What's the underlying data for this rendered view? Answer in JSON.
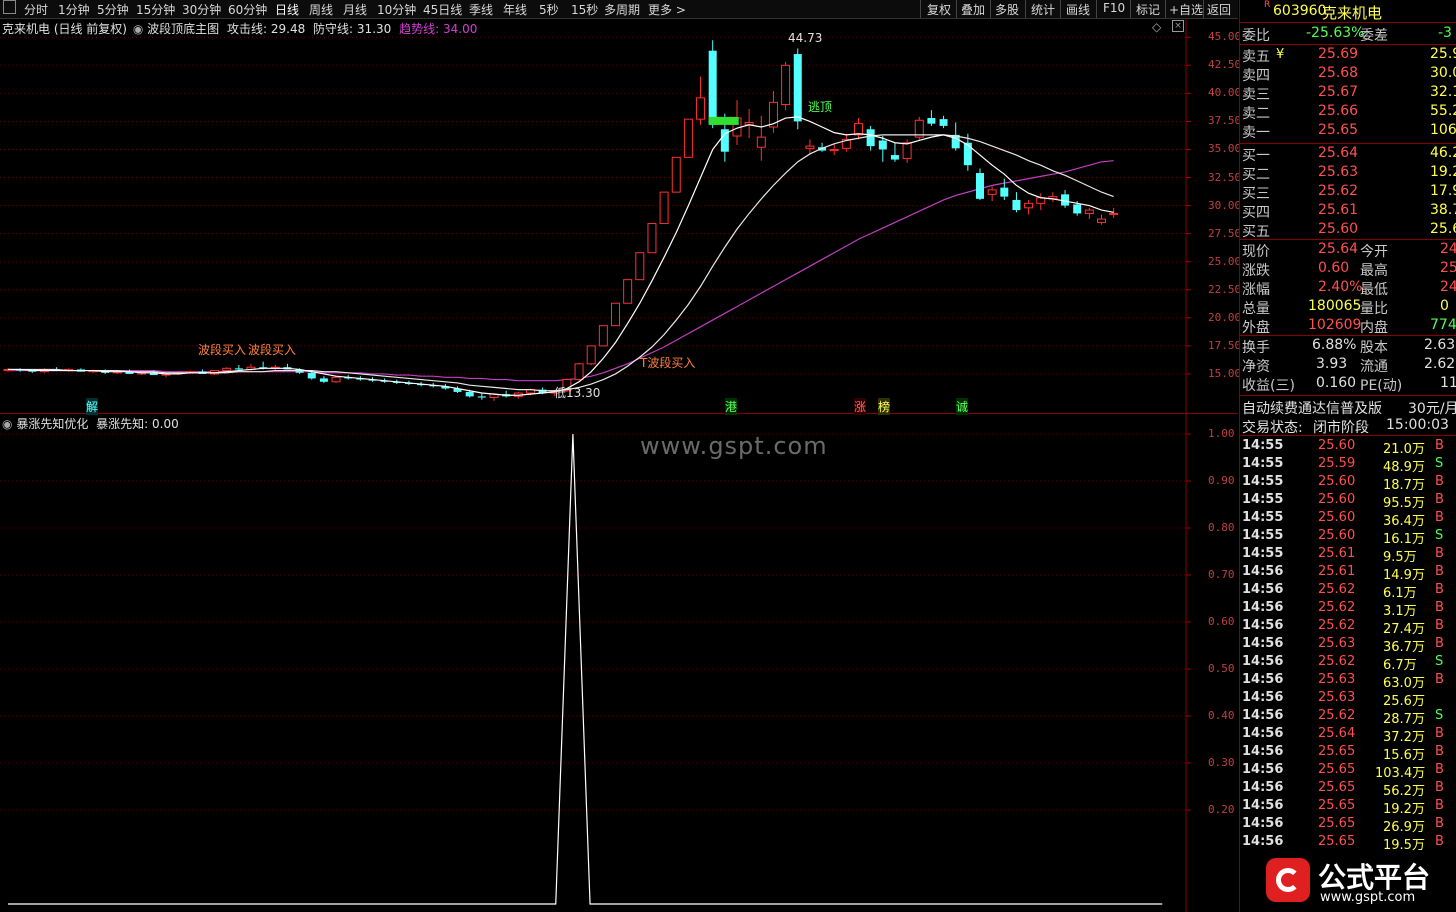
{
  "toolbar": {
    "grid_icon": "grid-icon",
    "periods": [
      "分时",
      "1分钟",
      "5分钟",
      "15分钟",
      "30分钟",
      "60分钟",
      "日线",
      "周线",
      "月线",
      "10分钟",
      "45日线",
      "季线",
      "年线",
      "5秒",
      "15秒",
      "多周期",
      "更多 >"
    ],
    "tools": [
      "复权",
      "叠加",
      "多股",
      "统计",
      "画线",
      "F10",
      "标记",
      "+自选",
      "返回"
    ]
  },
  "main_chart": {
    "stock_title": "克来机电 (日线 前复权)",
    "indicator_name": "波段顶底主图",
    "attack_label": "攻击线:",
    "attack_value": "29.48",
    "defense_label": "防守线:",
    "defense_value": "31.30",
    "trend_label": "趋势线:",
    "trend_value": "34.00",
    "peak_label": "44.73",
    "escape_label": "逃顶",
    "buy_label_1": "波段买入",
    "buy_label_2": "波段买入",
    "low_label": "低13.30",
    "buy_label_3": "T波段买入",
    "price_axis": [
      "45.00",
      "42.50",
      "40.00",
      "37.50",
      "35.00",
      "32.50",
      "30.00",
      "27.50",
      "25.00",
      "22.50",
      "20.00",
      "17.50",
      "15.00"
    ],
    "event_markers": [
      "解",
      "港",
      "涨",
      "榜",
      "诚"
    ]
  },
  "indicator_chart": {
    "title": "暴涨先知优化",
    "series_label": "暴涨先知:",
    "series_value": "0.00",
    "axis": [
      "1.00",
      "0.90",
      "0.80",
      "0.70",
      "0.60",
      "0.50",
      "0.40",
      "0.30",
      "0.20"
    ]
  },
  "watermark": "www.gspt.com",
  "quote_panel": {
    "badge": "R",
    "code": "603960",
    "name": "克来机电",
    "wei_bi_label": "委比",
    "wei_bi_value": "-25.63%",
    "wei_cha_label": "委差",
    "wei_cha_value": "-3",
    "asks": [
      {
        "label": "卖五",
        "price": "25.69",
        "vol": "25.9"
      },
      {
        "label": "卖四",
        "price": "25.68",
        "vol": "30.0"
      },
      {
        "label": "卖三",
        "price": "25.67",
        "vol": "32.1"
      },
      {
        "label": "卖二",
        "price": "25.66",
        "vol": "55.2"
      },
      {
        "label": "卖一",
        "price": "25.65",
        "vol": "106.4"
      }
    ],
    "bids": [
      {
        "label": "买一",
        "price": "25.64",
        "vol": "46.2"
      },
      {
        "label": "买二",
        "price": "25.63",
        "vol": "19.2"
      },
      {
        "label": "买三",
        "price": "25.62",
        "vol": "17.9"
      },
      {
        "label": "买四",
        "price": "25.61",
        "vol": "38.7"
      },
      {
        "label": "买五",
        "price": "25.60",
        "vol": "25.6"
      }
    ],
    "yen_mark": "¥",
    "stats": [
      {
        "l1": "现价",
        "v1": "25.64",
        "l2": "今开",
        "v2": "24"
      },
      {
        "l1": "涨跌",
        "v1": "0.60",
        "l2": "最高",
        "v2": "25"
      },
      {
        "l1": "涨幅",
        "v1": "2.40%",
        "l2": "最低",
        "v2": "24"
      },
      {
        "l1": "总量",
        "v1": "180065",
        "l2": "量比",
        "v2": "0"
      },
      {
        "l1": "外盘",
        "v1": "102609",
        "l2": "内盘",
        "v2": "774"
      }
    ],
    "stats2": [
      {
        "l1": "换手",
        "v1": "6.88%",
        "l2": "股本",
        "v2": "2.63"
      },
      {
        "l1": "净资",
        "v1": "3.93",
        "l2": "流通",
        "v2": "2.62"
      },
      {
        "l1": "收益(三)",
        "v1": "0.160",
        "l2": "PE(动)",
        "v2": "11"
      }
    ],
    "promo_text": "自动续费通达信普及版",
    "promo_price": "30元/月",
    "status_label": "交易状态:",
    "status_value": "闭市阶段",
    "status_time": "15:00:03"
  },
  "ticks": [
    {
      "t": "14:55",
      "p": "25.60",
      "v": "21.0万",
      "s": "B"
    },
    {
      "t": "14:55",
      "p": "25.59",
      "v": "48.9万",
      "s": "S"
    },
    {
      "t": "14:55",
      "p": "25.60",
      "v": "18.7万",
      "s": "B"
    },
    {
      "t": "14:55",
      "p": "25.60",
      "v": "95.5万",
      "s": "B"
    },
    {
      "t": "14:55",
      "p": "25.60",
      "v": "36.4万",
      "s": "B"
    },
    {
      "t": "14:55",
      "p": "25.60",
      "v": "16.1万",
      "s": "S"
    },
    {
      "t": "14:55",
      "p": "25.61",
      "v": "9.5万",
      "s": "B"
    },
    {
      "t": "14:56",
      "p": "25.61",
      "v": "14.9万",
      "s": "B"
    },
    {
      "t": "14:56",
      "p": "25.62",
      "v": "6.1万",
      "s": "B"
    },
    {
      "t": "14:56",
      "p": "25.62",
      "v": "3.1万",
      "s": "B"
    },
    {
      "t": "14:56",
      "p": "25.62",
      "v": "27.4万",
      "s": "B"
    },
    {
      "t": "14:56",
      "p": "25.63",
      "v": "36.7万",
      "s": "B"
    },
    {
      "t": "14:56",
      "p": "25.62",
      "v": "6.7万",
      "s": "S"
    },
    {
      "t": "14:56",
      "p": "25.63",
      "v": "63.0万",
      "s": "B"
    },
    {
      "t": "14:56",
      "p": "25.63",
      "v": "25.6万",
      "s": ""
    },
    {
      "t": "14:56",
      "p": "25.62",
      "v": "28.7万",
      "s": "S"
    },
    {
      "t": "14:56",
      "p": "25.64",
      "v": "37.2万",
      "s": "B"
    },
    {
      "t": "14:56",
      "p": "25.65",
      "v": "15.6万",
      "s": "B"
    },
    {
      "t": "14:56",
      "p": "25.65",
      "v": "103.4万",
      "s": "B"
    },
    {
      "t": "14:56",
      "p": "25.65",
      "v": "56.2万",
      "s": "B"
    },
    {
      "t": "14:56",
      "p": "25.65",
      "v": "19.2万",
      "s": "B"
    },
    {
      "t": "14:56",
      "p": "25.65",
      "v": "26.9万",
      "s": "B"
    },
    {
      "t": "14:56",
      "p": "25.65",
      "v": "19.5万",
      "s": "B"
    }
  ],
  "brand": {
    "name": "公式平台",
    "url": "www.gspt.com"
  },
  "chart_data": [
    {
      "type": "candlestick",
      "ylim": [
        12.5,
        46
      ],
      "candles": [
        [
          15.3,
          15.5,
          15.2,
          15.4
        ],
        [
          15.4,
          15.5,
          15.2,
          15.3
        ],
        [
          15.3,
          15.4,
          15.1,
          15.2
        ],
        [
          15.2,
          15.5,
          15.1,
          15.4
        ],
        [
          15.4,
          15.6,
          15.3,
          15.3
        ],
        [
          15.3,
          15.5,
          15.2,
          15.4
        ],
        [
          15.4,
          15.5,
          15.2,
          15.2
        ],
        [
          15.2,
          15.4,
          15.1,
          15.3
        ],
        [
          15.3,
          15.4,
          15.0,
          15.1
        ],
        [
          15.1,
          15.3,
          15.0,
          15.2
        ],
        [
          15.2,
          15.4,
          15.1,
          15.0
        ],
        [
          15.0,
          15.2,
          14.9,
          15.1
        ],
        [
          15.1,
          15.3,
          15.0,
          14.9
        ],
        [
          14.9,
          15.1,
          14.7,
          15.0
        ],
        [
          15.0,
          15.2,
          14.9,
          15.1
        ],
        [
          15.1,
          15.3,
          15.0,
          15.2
        ],
        [
          15.2,
          15.4,
          15.1,
          15.0
        ],
        [
          15.0,
          15.2,
          14.9,
          15.3
        ],
        [
          15.3,
          15.6,
          15.2,
          15.5
        ],
        [
          15.5,
          15.8,
          15.3,
          15.4
        ],
        [
          15.4,
          15.9,
          15.3,
          15.6
        ],
        [
          15.6,
          16.1,
          15.4,
          15.5
        ],
        [
          15.5,
          15.8,
          15.3,
          15.6
        ],
        [
          15.6,
          15.9,
          15.4,
          15.4
        ],
        [
          15.4,
          15.5,
          15.0,
          15.1
        ],
        [
          15.1,
          15.2,
          14.5,
          14.6
        ],
        [
          14.6,
          14.8,
          14.2,
          14.3
        ],
        [
          14.3,
          14.8,
          14.2,
          14.7
        ],
        [
          14.7,
          14.9,
          14.5,
          14.6
        ],
        [
          14.6,
          14.8,
          14.4,
          14.5
        ],
        [
          14.5,
          14.7,
          14.3,
          14.4
        ],
        [
          14.4,
          14.6,
          14.2,
          14.3
        ],
        [
          14.3,
          14.5,
          14.1,
          14.2
        ],
        [
          14.2,
          14.4,
          14.0,
          14.1
        ],
        [
          14.1,
          14.3,
          13.9,
          14.0
        ],
        [
          14.0,
          14.2,
          13.8,
          13.9
        ],
        [
          13.9,
          14.1,
          13.6,
          13.7
        ],
        [
          13.7,
          13.9,
          13.3,
          13.4
        ],
        [
          13.4,
          13.6,
          12.9,
          13.0
        ],
        [
          13.0,
          13.3,
          12.7,
          12.9
        ],
        [
          12.9,
          13.3,
          12.6,
          13.2
        ],
        [
          13.2,
          13.5,
          12.9,
          13.0
        ],
        [
          13.0,
          13.4,
          12.8,
          13.3
        ],
        [
          13.3,
          13.7,
          13.1,
          13.6
        ],
        [
          13.6,
          13.8,
          13.2,
          13.3
        ],
        [
          13.3,
          13.6,
          13.0,
          13.5
        ],
        [
          13.5,
          14.6,
          13.4,
          14.5
        ],
        [
          14.5,
          16.0,
          14.4,
          15.9
        ],
        [
          15.9,
          17.5,
          15.8,
          17.5
        ],
        [
          17.5,
          19.3,
          17.5,
          19.3
        ],
        [
          19.3,
          21.3,
          19.3,
          21.3
        ],
        [
          21.3,
          23.4,
          21.3,
          23.4
        ],
        [
          23.4,
          25.8,
          23.4,
          25.8
        ],
        [
          25.8,
          28.4,
          25.8,
          28.4
        ],
        [
          28.4,
          31.2,
          28.4,
          31.2
        ],
        [
          31.2,
          34.3,
          31.2,
          34.3
        ],
        [
          34.3,
          37.7,
          34.3,
          37.7
        ],
        [
          37.7,
          41.5,
          37.2,
          39.6
        ],
        [
          43.8,
          44.73,
          36.9,
          37.2
        ],
        [
          36.8,
          38.2,
          33.9,
          34.8
        ],
        [
          36.2,
          39.4,
          35.4,
          37.8
        ],
        [
          37.2,
          38.6,
          36.0,
          37.4
        ],
        [
          35.2,
          38.0,
          34.0,
          36.1
        ],
        [
          37.0,
          40.2,
          36.5,
          39.2
        ],
        [
          39.0,
          42.8,
          38.5,
          42.5
        ],
        [
          43.5,
          44.0,
          36.8,
          37.5
        ],
        [
          35.1,
          35.9,
          34.6,
          35.3
        ],
        [
          35.2,
          35.6,
          34.8,
          34.9
        ],
        [
          34.9,
          35.5,
          34.5,
          35.0
        ],
        [
          35.1,
          36.4,
          34.8,
          35.9
        ],
        [
          36.3,
          37.8,
          35.9,
          37.3
        ],
        [
          36.8,
          37.1,
          34.9,
          35.3
        ],
        [
          35.8,
          36.2,
          33.9,
          35.0
        ],
        [
          34.5,
          35.6,
          33.9,
          34.1
        ],
        [
          34.2,
          35.9,
          33.8,
          35.6
        ],
        [
          36.1,
          37.9,
          35.8,
          37.6
        ],
        [
          37.8,
          38.5,
          37.1,
          37.3
        ],
        [
          37.7,
          38.0,
          36.9,
          37.1
        ],
        [
          36.3,
          37.4,
          34.9,
          35.1
        ],
        [
          35.6,
          36.4,
          33.1,
          33.6
        ],
        [
          32.9,
          33.3,
          30.5,
          30.6
        ],
        [
          31.0,
          31.7,
          30.4,
          31.4
        ],
        [
          31.6,
          32.4,
          30.5,
          30.8
        ],
        [
          30.5,
          31.2,
          29.4,
          29.6
        ],
        [
          29.8,
          30.5,
          29.2,
          30.2
        ],
        [
          30.2,
          31.1,
          29.6,
          30.7
        ],
        [
          30.6,
          31.2,
          30.3,
          30.8
        ],
        [
          31.0,
          31.4,
          29.8,
          30.0
        ],
        [
          30.1,
          30.4,
          29.1,
          29.3
        ],
        [
          29.3,
          29.8,
          28.8,
          29.6
        ],
        [
          28.5,
          29.2,
          28.3,
          28.8
        ],
        [
          29.2,
          29.8,
          28.9,
          29.3
        ]
      ],
      "ma_short": [
        15.4,
        15.4,
        15.3,
        15.3,
        15.3,
        15.3,
        15.3,
        15.3,
        15.2,
        15.2,
        15.2,
        15.1,
        15.1,
        15.0,
        15.0,
        15.1,
        15.1,
        15.1,
        15.2,
        15.3,
        15.4,
        15.5,
        15.5,
        15.5,
        15.4,
        15.2,
        15.0,
        14.8,
        14.7,
        14.6,
        14.5,
        14.4,
        14.3,
        14.2,
        14.1,
        14.0,
        13.9,
        13.7,
        13.5,
        13.3,
        13.2,
        13.1,
        13.1,
        13.2,
        13.3,
        13.4,
        13.7,
        14.3,
        15.2,
        16.4,
        17.8,
        19.5,
        21.3,
        23.3,
        25.4,
        27.6,
        30.0,
        32.5,
        35.0,
        36.4,
        36.9,
        37.2,
        37.0,
        37.3,
        37.8,
        37.9,
        37.5,
        37.0,
        36.5,
        36.3,
        36.4,
        36.3,
        36.0,
        35.6,
        35.5,
        35.8,
        36.1,
        36.3,
        36.0,
        35.4,
        34.5,
        33.6,
        32.8,
        31.8,
        31.1,
        30.7,
        30.6,
        30.4,
        30.2,
        30.0,
        29.6,
        29.4
      ],
      "ma_long": [
        15.4,
        15.4,
        15.4,
        15.4,
        15.4,
        15.3,
        15.3,
        15.3,
        15.3,
        15.3,
        15.2,
        15.2,
        15.2,
        15.1,
        15.1,
        15.1,
        15.1,
        15.1,
        15.1,
        15.2,
        15.2,
        15.2,
        15.3,
        15.3,
        15.3,
        15.3,
        15.2,
        15.2,
        15.1,
        15.0,
        14.9,
        14.8,
        14.7,
        14.6,
        14.5,
        14.4,
        14.3,
        14.2,
        14.0,
        13.9,
        13.8,
        13.7,
        13.6,
        13.6,
        13.5,
        13.5,
        13.6,
        13.8,
        14.1,
        14.5,
        15.0,
        15.7,
        16.5,
        17.4,
        18.5,
        19.8,
        21.2,
        22.8,
        24.6,
        26.3,
        27.9,
        29.3,
        30.6,
        31.8,
        32.9,
        33.9,
        34.6,
        35.1,
        35.5,
        35.8,
        36.0,
        36.2,
        36.3,
        36.3,
        36.3,
        36.3,
        36.3,
        36.3,
        36.2,
        36.0,
        35.7,
        35.3,
        34.9,
        34.5,
        34.0,
        33.6,
        33.1,
        32.7,
        32.2,
        31.7,
        31.2,
        30.8
      ],
      "ma_trend": [
        15.3,
        15.3,
        15.3,
        15.3,
        15.3,
        15.3,
        15.3,
        15.3,
        15.3,
        15.3,
        15.3,
        15.3,
        15.3,
        15.2,
        15.2,
        15.2,
        15.2,
        15.2,
        15.2,
        15.2,
        15.2,
        15.2,
        15.2,
        15.2,
        15.2,
        15.2,
        15.1,
        15.1,
        15.1,
        15.1,
        15.0,
        15.0,
        14.9,
        14.9,
        14.8,
        14.8,
        14.7,
        14.7,
        14.6,
        14.6,
        14.5,
        14.5,
        14.4,
        14.4,
        14.4,
        14.4,
        14.5,
        14.6,
        14.8,
        15.1,
        15.5,
        15.9,
        16.4,
        16.9,
        17.4,
        18.0,
        18.6,
        19.2,
        19.8,
        20.4,
        21.0,
        21.6,
        22.2,
        22.8,
        23.4,
        24.0,
        24.6,
        25.2,
        25.8,
        26.4,
        27.0,
        27.5,
        28.0,
        28.5,
        29.0,
        29.5,
        30.0,
        30.5,
        30.9,
        31.2,
        31.5,
        31.8,
        32.0,
        32.2,
        32.4,
        32.6,
        32.8,
        33.0,
        33.3,
        33.6,
        33.9,
        34.0
      ]
    },
    {
      "type": "line",
      "ylim": [
        0,
        1.0
      ],
      "series": [
        {
          "values": [
            0,
            0,
            0,
            0,
            0,
            0,
            0,
            0,
            0,
            0,
            0,
            0,
            0,
            0,
            0,
            0,
            0,
            0,
            0,
            0,
            0,
            0,
            0,
            0,
            0,
            0,
            0,
            0,
            0,
            0,
            0,
            0,
            0,
            0,
            0,
            0,
            0,
            0,
            0,
            0,
            0,
            0,
            1.0,
            0,
            0,
            0,
            0,
            0,
            0,
            0,
            0,
            0,
            0,
            0,
            0,
            0,
            0,
            0,
            0,
            0,
            0,
            0,
            0,
            0,
            0,
            0,
            0,
            0,
            0,
            0,
            0,
            0,
            0,
            0,
            0,
            0,
            0,
            0,
            0,
            0,
            0,
            0,
            0,
            0,
            0,
            0,
            0,
            0,
            0,
            0,
            0,
            0
          ]
        }
      ]
    }
  ]
}
